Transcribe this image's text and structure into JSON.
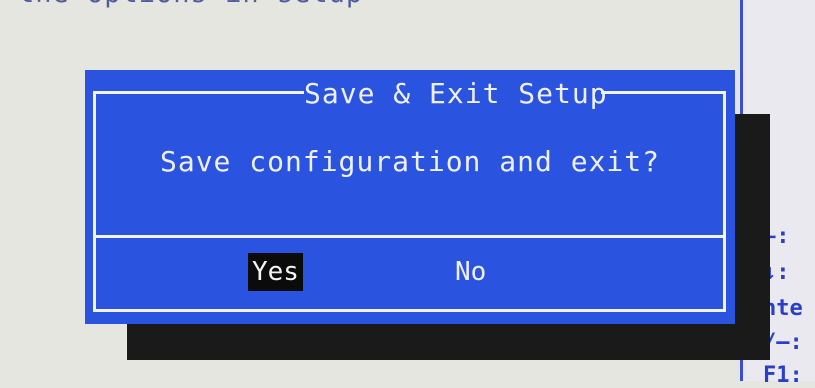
{
  "background": {
    "top_text": "the options in setup",
    "key_hints": [
      "←:",
      "↓:",
      "nte",
      "/–:",
      "F1:"
    ]
  },
  "dialog": {
    "title": "Save & Exit Setup",
    "message": "Save configuration and exit?",
    "buttons": {
      "yes": "Yes",
      "no": "No"
    },
    "selected": "Yes"
  },
  "colors": {
    "dialog_background": "#2a54df",
    "dialog_text": "#eef0fb",
    "selected_button_background": "#0b0b0b",
    "screen_background": "#e6e6e1",
    "hint_text": "#2a3fc8"
  }
}
